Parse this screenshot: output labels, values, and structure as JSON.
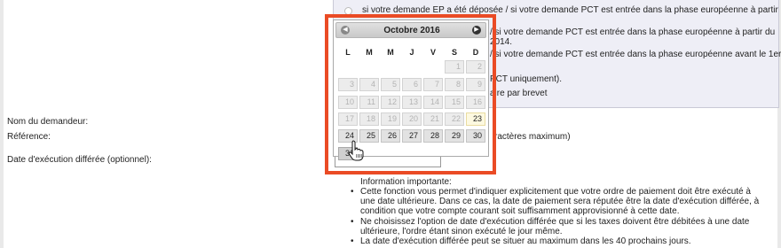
{
  "options": [
    {
      "line1": "si votre demande EP a été déposée / si votre demande PCT est entrée dans la phase européenne à partir du"
    },
    {
      "line1": "/ si votre demande PCT est entrée dans la phase européenne à partir du",
      "line2": "2014."
    },
    {
      "line1": "/ si votre demande PCT est entrée dans la phase européenne avant le 1er"
    },
    {
      "line1": "PCT uniquement)."
    },
    {
      "line1": "aire par brevet"
    }
  ],
  "form": {
    "applicant_label": "Nom du demandeur:",
    "reference_label": "Référence:",
    "reference_hint": "ractères maximum)",
    "deferred_label": "Date d'exécution différée (optionnel):",
    "date_value": ""
  },
  "datepicker": {
    "month_title": "Octobre 2016",
    "prev_label": "◀",
    "next_label": "▶",
    "weekdays": [
      "L",
      "M",
      "M",
      "J",
      "V",
      "S",
      "D"
    ],
    "rows": [
      [
        "",
        "",
        "",
        "",
        "",
        "1",
        "2"
      ],
      [
        "3",
        "4",
        "5",
        "6",
        "7",
        "8",
        "9"
      ],
      [
        "10",
        "11",
        "12",
        "13",
        "14",
        "15",
        "16"
      ],
      [
        "17",
        "18",
        "19",
        "20",
        "21",
        "22",
        "23"
      ],
      [
        "24",
        "25",
        "26",
        "27",
        "28",
        "29",
        "30"
      ],
      [
        "31",
        "",
        "",
        "",
        "",
        "",
        ""
      ]
    ]
  },
  "info": {
    "title": "Information importante:",
    "items": [
      "Cette fonction vous permet d'indiquer explicitement que votre ordre de paiement doit être exécuté à une date ultérieure. Dans ce cas, la date de paiement sera réputée être la date d'exécution différée, à condition que votre compte courant soit suffisamment approvisionné à cette date.",
      "Ne choisissez l'option de date d'exécution différée que si les taxes doivent être débitées à une date ultérieure, l'ordre étant sinon exécuté le jour même.",
      "La date d'exécution différée peut se situer au maximum dans les 40 prochains jours."
    ]
  },
  "colors": {
    "highlight": "#ea4b25",
    "panel": "#eeeef6"
  }
}
